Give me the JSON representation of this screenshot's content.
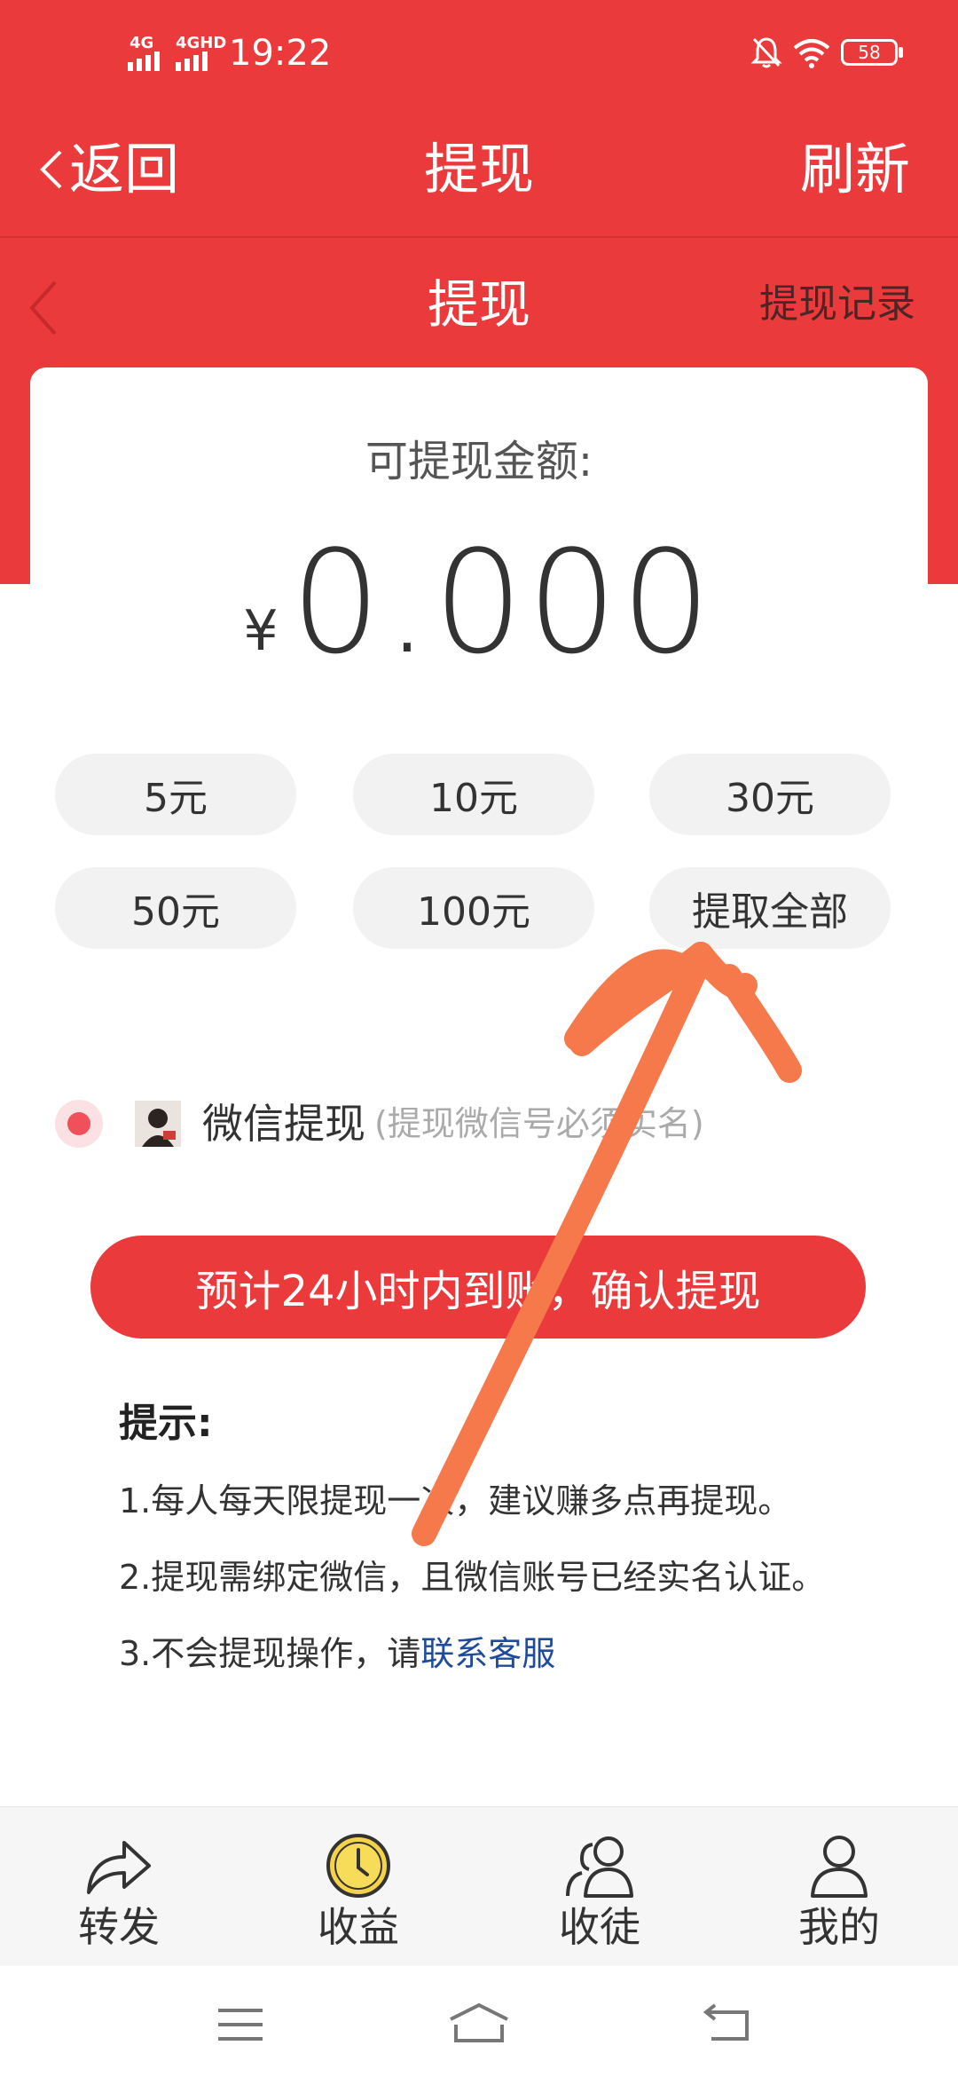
{
  "status_bar": {
    "network1": "4G",
    "network2": "4GHD",
    "time": "19:22",
    "battery": "58"
  },
  "header": {
    "back_label": "返回",
    "title": "提现",
    "refresh_label": "刷新"
  },
  "subheader": {
    "title": "提现",
    "records_label": "提现记录"
  },
  "balance": {
    "label": "可提现金额:",
    "currency": "¥",
    "amount": "0.000"
  },
  "amount_options": [
    "5元",
    "10元",
    "30元",
    "50元",
    "100元",
    "提取全部"
  ],
  "withdraw_method": {
    "label": "微信提现",
    "note": "(提现微信号必须实名)"
  },
  "confirm_label": "预计24小时内到账，确认提现",
  "tips": {
    "title": "提示:",
    "item1": "1.每人每天限提现一次，建议赚多点再提现。",
    "item2": "2.提现需绑定微信，且微信账号已经实名认证。",
    "item3_prefix": "3.不会提现操作，请",
    "item3_link": "联系客服"
  },
  "bottom_nav": [
    {
      "label": "转发",
      "icon": "share-icon"
    },
    {
      "label": "收益",
      "icon": "clock-icon"
    },
    {
      "label": "收徒",
      "icon": "users-icon"
    },
    {
      "label": "我的",
      "icon": "user-icon"
    }
  ],
  "colors": {
    "primary": "#ea3a3b",
    "link": "#1e4b9c",
    "annotation": "#f5794a",
    "chip_bg": "#f2f2f2"
  }
}
